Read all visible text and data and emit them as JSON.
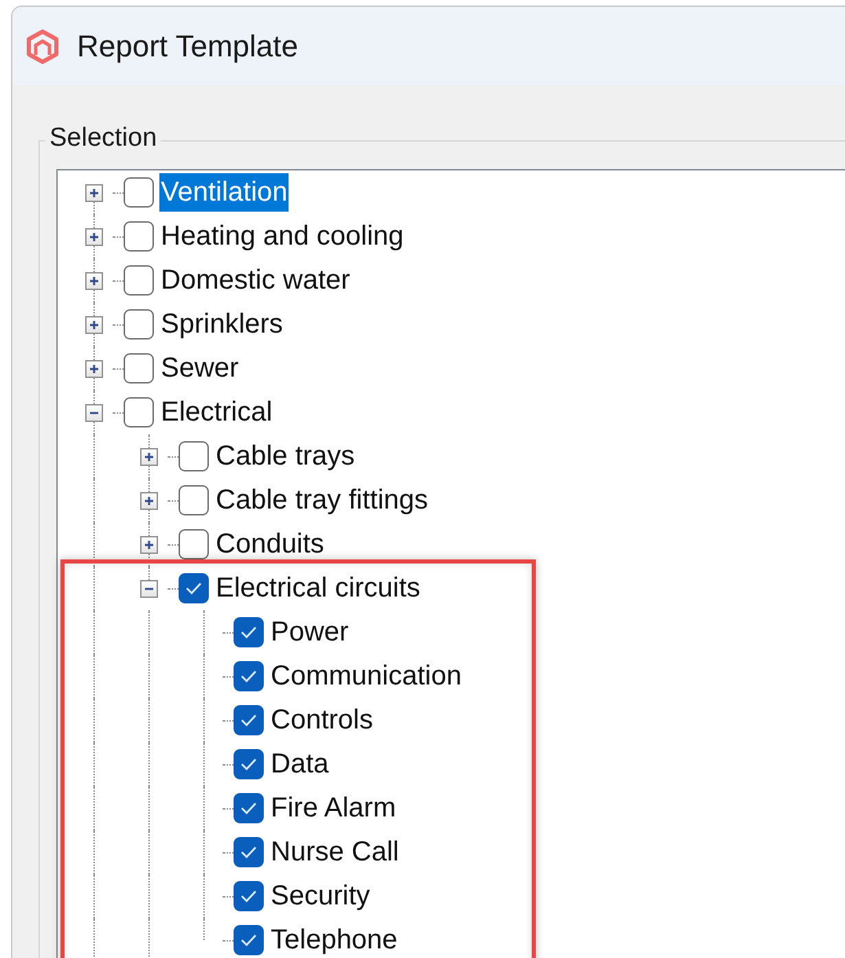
{
  "window": {
    "title": "Report Template"
  },
  "selection": {
    "label": "Selection",
    "tree": [
      {
        "label": "Ventilation",
        "checked": false,
        "expanded": false,
        "selected": true
      },
      {
        "label": "Heating and cooling",
        "checked": false,
        "expanded": false,
        "selected": false
      },
      {
        "label": "Domestic water",
        "checked": false,
        "expanded": false,
        "selected": false
      },
      {
        "label": "Sprinklers",
        "checked": false,
        "expanded": false,
        "selected": false
      },
      {
        "label": "Sewer",
        "checked": false,
        "expanded": false,
        "selected": false
      },
      {
        "label": "Electrical",
        "checked": false,
        "expanded": true,
        "selected": false,
        "children": [
          {
            "label": "Cable trays",
            "checked": false,
            "expanded": false,
            "selected": false
          },
          {
            "label": "Cable tray fittings",
            "checked": false,
            "expanded": false,
            "selected": false
          },
          {
            "label": "Conduits",
            "checked": false,
            "expanded": false,
            "selected": false
          },
          {
            "label": "Electrical circuits",
            "checked": true,
            "expanded": true,
            "selected": false,
            "highlighted": true,
            "children": [
              {
                "label": "Power",
                "checked": true,
                "selected": false
              },
              {
                "label": "Communication",
                "checked": true,
                "selected": false
              },
              {
                "label": "Controls",
                "checked": true,
                "selected": false
              },
              {
                "label": "Data",
                "checked": true,
                "selected": false
              },
              {
                "label": "Fire Alarm",
                "checked": true,
                "selected": false
              },
              {
                "label": "Nurse Call",
                "checked": true,
                "selected": false
              },
              {
                "label": "Security",
                "checked": true,
                "selected": false
              },
              {
                "label": "Telephone",
                "checked": true,
                "selected": false
              }
            ]
          }
        ]
      }
    ]
  }
}
